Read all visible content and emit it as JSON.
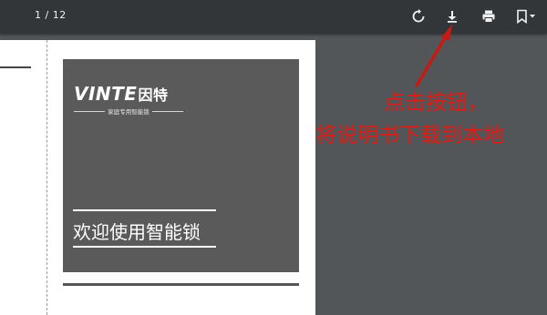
{
  "toolbar": {
    "page_indicator": "1 / 12",
    "buttons": [
      {
        "name": "rotate",
        "icon": "rotate-icon"
      },
      {
        "name": "download",
        "icon": "download-icon"
      },
      {
        "name": "print",
        "icon": "print-icon"
      },
      {
        "name": "bookmark",
        "icon": "bookmark-icon"
      }
    ]
  },
  "document": {
    "cover": {
      "logo_text": "VINTE",
      "logo_cn": "因特",
      "logo_tagline": "家庭专用智能锁",
      "title": "欢迎使用智能锁"
    }
  },
  "annotation": {
    "line1": "点击按钮，",
    "line2": "将说明书下载到本地",
    "color": "#e11b14"
  },
  "colors": {
    "toolbar_bg": "#323639",
    "viewer_bg": "#525659",
    "cover_bg": "#5a5a5a"
  }
}
